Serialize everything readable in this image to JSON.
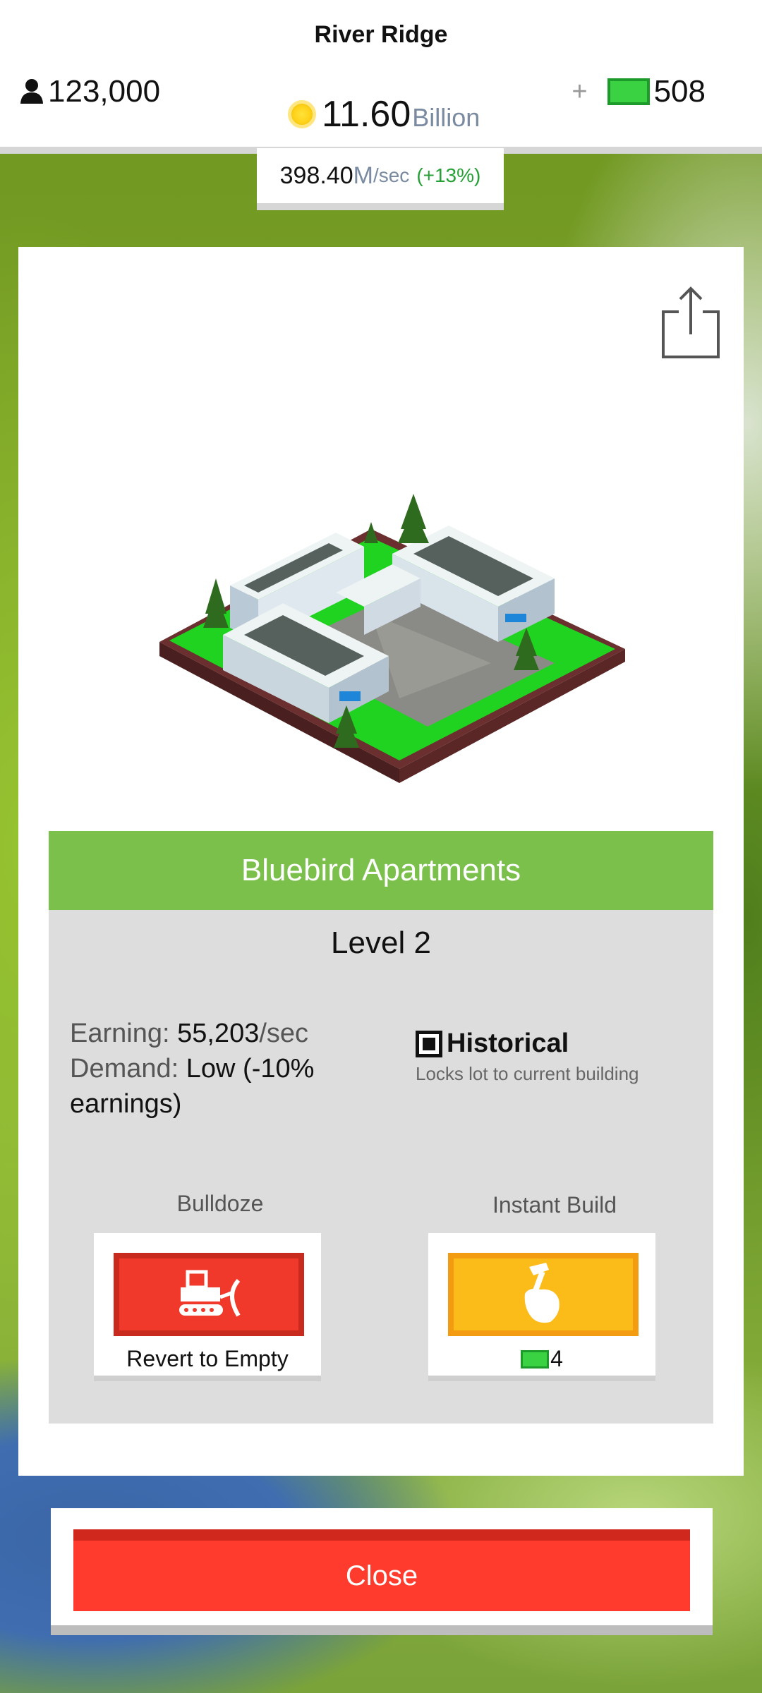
{
  "header": {
    "city_name": "River Ridge",
    "population": "123,000",
    "cash_value": "11.60",
    "cash_unit": "Billion",
    "plus": "+",
    "bucks": "508",
    "rate_value": "398.40",
    "rate_unit": "M",
    "rate_per": "/sec",
    "rate_change": "(+13%)"
  },
  "building": {
    "name": "Bluebird Apartments",
    "level": "Level 2",
    "earning_label": "Earning:",
    "earning_value": "55,203",
    "earning_unit": "/sec",
    "demand_label": "Demand:",
    "demand_value": "Low (-10% earnings)",
    "historical_label": "Historical",
    "historical_desc": "Locks lot to current building",
    "historical_checked": true
  },
  "actions": {
    "bulldoze_label": "Bulldoze",
    "bulldoze_caption": "Revert to Empty",
    "instant_label": "Instant Build",
    "instant_cost": "4"
  },
  "close_label": "Close",
  "colors": {
    "title_green": "#7cc04c",
    "bulldoze_red": "#f0392b",
    "build_yellow": "#fbbc1a",
    "close_red": "#ff3b2e",
    "bucks_green": "#3ad142"
  },
  "icons": {
    "population": "person-icon",
    "cash": "coin-icon",
    "bucks": "bill-icon",
    "share": "share-icon",
    "bulldoze": "bulldozer-icon",
    "instant_build": "hammer-hand-icon"
  }
}
